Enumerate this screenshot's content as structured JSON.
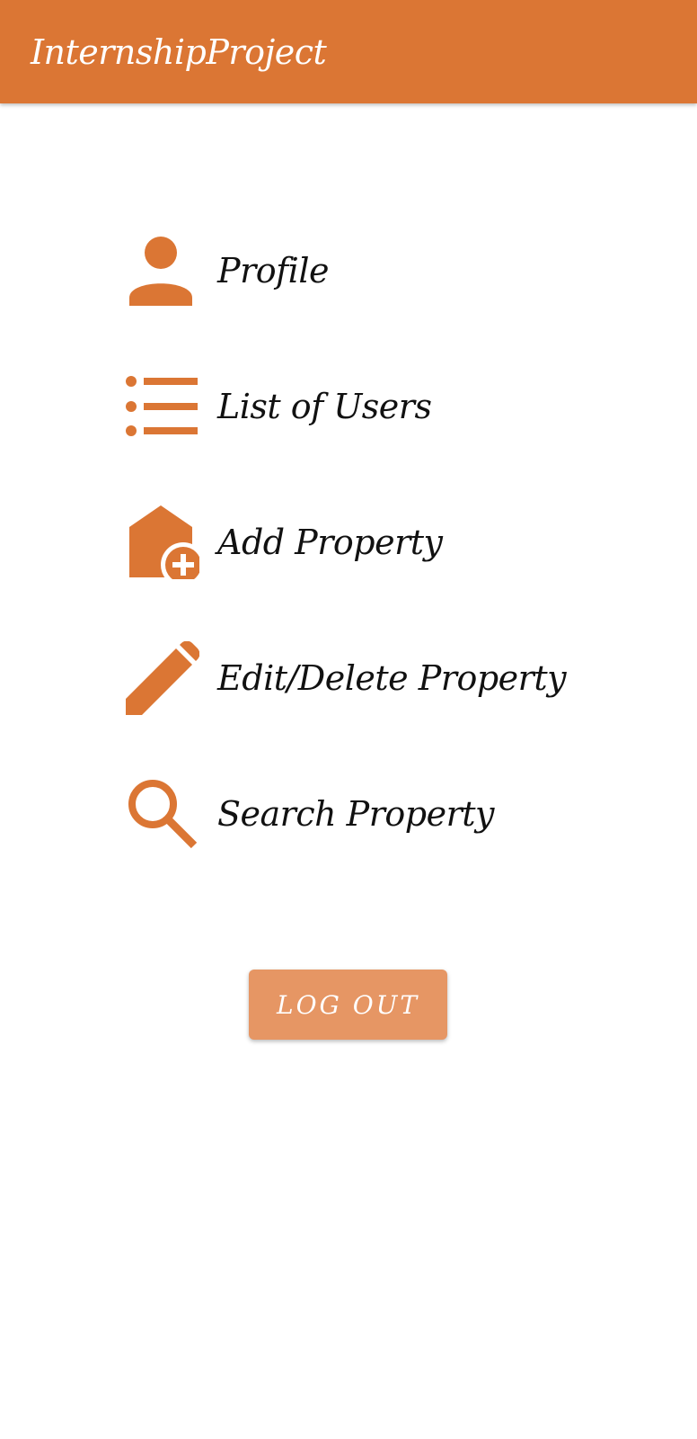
{
  "app_bar": {
    "title": "InternshipProject"
  },
  "menu": {
    "items": [
      {
        "label": "Profile",
        "icon": "person-icon"
      },
      {
        "label": "List of Users",
        "icon": "list-icon"
      },
      {
        "label": "Add Property",
        "icon": "add-home-icon"
      },
      {
        "label": "Edit/Delete Property",
        "icon": "pencil-icon"
      },
      {
        "label": "Search Property",
        "icon": "search-icon"
      }
    ]
  },
  "logout": {
    "label": "LOG OUT"
  },
  "colors": {
    "accent": "#DB7634",
    "button": "#E69664",
    "text": "#111111",
    "background": "#FFFFFF"
  }
}
